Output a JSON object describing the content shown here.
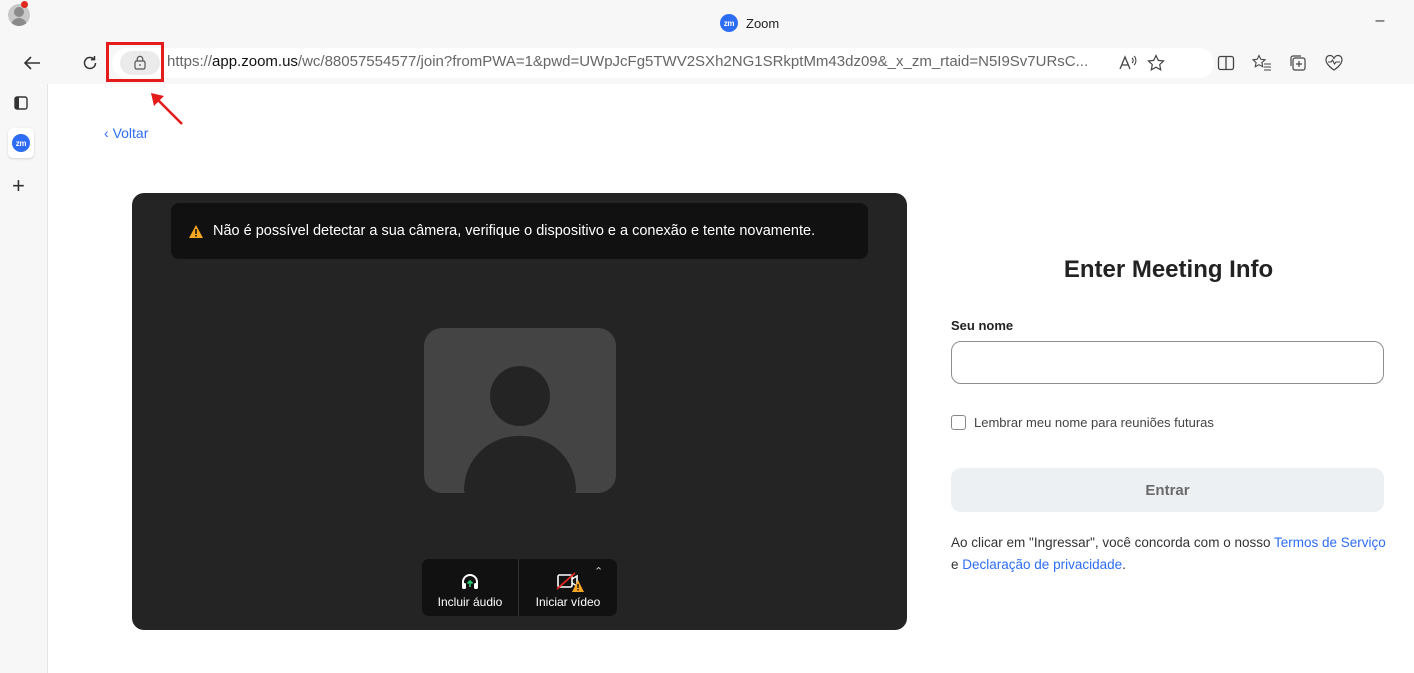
{
  "window": {
    "tab_title": "Zoom",
    "logo_text": "zm",
    "minimize_symbol": "–"
  },
  "toolbar": {
    "url_prefix": "https://",
    "url_host": "app.zoom.us",
    "url_rest": "/wc/88057554577/join?fromPWA=1&pwd=UWpJcFg5TWV2SXh2NG1SRkptMm43dz09&_x_zm_rtaid=N5I9Sv7URsC..."
  },
  "sidebar": {
    "active_tab_logo": "zm",
    "new_tab_symbol": "+"
  },
  "page": {
    "back_label": "Voltar",
    "camera_warning": "Não é possível detectar a sua câmera, verifique o dispositivo e a conexão e tente novamente.",
    "controls": {
      "audio_label": "Incluir áudio",
      "video_label": "Iniciar vídeo"
    }
  },
  "form": {
    "title": "Enter Meeting Info",
    "name_label": "Seu nome",
    "name_value": "",
    "remember_label": "Lembrar meu nome para reuniões futuras",
    "join_label": "Entrar",
    "terms_prefix": "Ao clicar em \"Ingressar\", você concorda com o nosso ",
    "terms_link": "Termos de Serviço",
    "terms_mid": " e ",
    "privacy_link": "Declaração de privacidade",
    "terms_suffix": "."
  },
  "colors": {
    "accent": "#2d6df6",
    "highlight": "#e41c1c",
    "warning": "#f5a623",
    "video_bg": "#242424"
  }
}
